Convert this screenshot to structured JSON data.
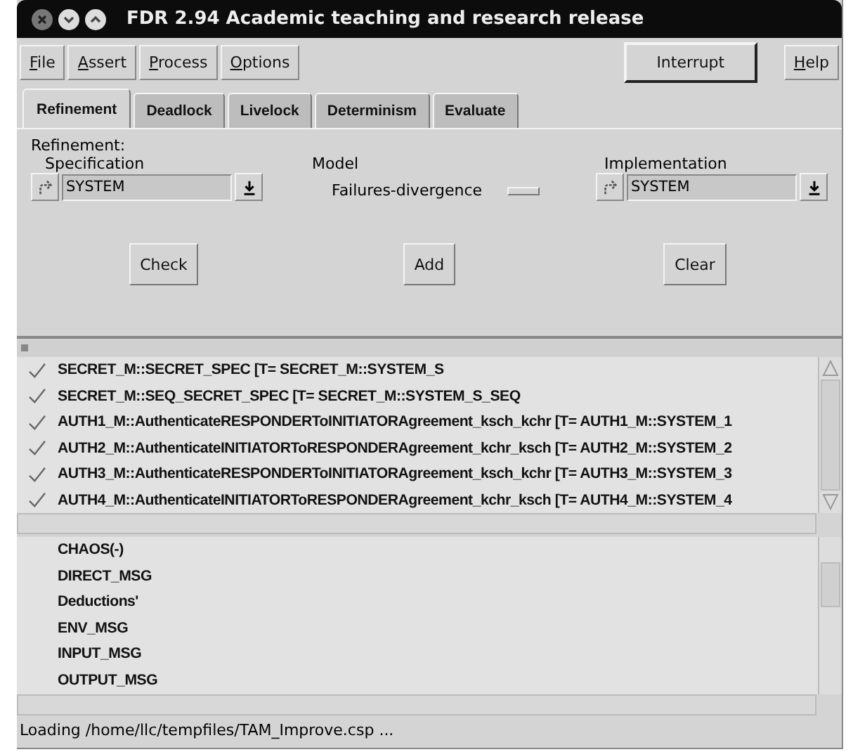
{
  "window": {
    "title": "FDR 2.94 Academic teaching and research release"
  },
  "menu": [
    {
      "mnemonic": "F",
      "rest": "ile"
    },
    {
      "mnemonic": "A",
      "rest": "ssert"
    },
    {
      "mnemonic": "P",
      "rest": "rocess"
    },
    {
      "mnemonic": "O",
      "rest": "ptions"
    }
  ],
  "interrupt_button": "Interrupt",
  "help_menu": {
    "mnemonic": "H",
    "rest": "elp"
  },
  "tabs": [
    {
      "label": "Refinement",
      "selected": true
    },
    {
      "label": "Deadlock",
      "selected": false
    },
    {
      "label": "Livelock",
      "selected": false
    },
    {
      "label": "Determinism",
      "selected": false
    },
    {
      "label": "Evaluate",
      "selected": false
    }
  ],
  "refinement": {
    "heading": "Refinement:",
    "specification": {
      "label": "Specification",
      "value": "SYSTEM"
    },
    "model": {
      "label": "Model",
      "value": "Failures-divergence"
    },
    "implementation": {
      "label": "Implementation",
      "value": "SYSTEM"
    },
    "buttons": [
      "Check",
      "Add",
      "Clear"
    ]
  },
  "assertions": [
    {
      "text": "SECRET_M::SECRET_SPEC [T= SECRET_M::SYSTEM_S",
      "checked": true
    },
    {
      "text": "SECRET_M::SEQ_SECRET_SPEC [T= SECRET_M::SYSTEM_S_SEQ",
      "checked": true
    },
    {
      "text": "AUTH1_M::AuthenticateRESPONDERToINITIATORAgreement_ksch_kchr [T= AUTH1_M::SYSTEM_1",
      "checked": true
    },
    {
      "text": "AUTH2_M::AuthenticateINITIATORToRESPONDERAgreement_kchr_ksch [T= AUTH2_M::SYSTEM_2",
      "checked": true
    },
    {
      "text": "AUTH3_M::AuthenticateRESPONDERToINITIATORAgreement_ksch_kchr [T= AUTH3_M::SYSTEM_3",
      "checked": true
    },
    {
      "text": "AUTH4_M::AuthenticateINITIATORToRESPONDERAgreement_kchr_ksch [T= AUTH4_M::SYSTEM_4",
      "checked": true
    }
  ],
  "processes": [
    "CHAOS(-)",
    "DIRECT_MSG",
    "Deductions'",
    "ENV_MSG",
    "INPUT_MSG",
    "OUTPUT_MSG"
  ],
  "status_bar": "Loading /home/llc/tempfiles/TAM_Improve.csp ..."
}
